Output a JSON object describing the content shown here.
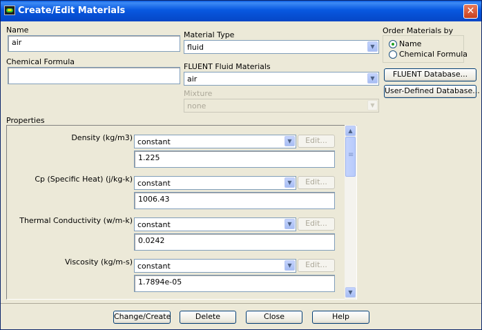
{
  "window": {
    "title": "Create/Edit Materials",
    "close_glyph": "✕"
  },
  "name": {
    "label": "Name",
    "value": "air"
  },
  "chemical_formula": {
    "label": "Chemical Formula",
    "value": ""
  },
  "material_type": {
    "label": "Material Type",
    "value": "fluid"
  },
  "fluent_materials": {
    "label": "FLUENT Fluid Materials",
    "value": "air"
  },
  "mixture": {
    "label": "Mixture",
    "value": "none"
  },
  "order_by": {
    "label": "Order Materials by",
    "options": [
      {
        "label": "Name",
        "selected": true
      },
      {
        "label": "Chemical Formula",
        "selected": false
      }
    ]
  },
  "database_buttons": {
    "fluent": "FLUENT Database...",
    "user": "User-Defined Database..."
  },
  "properties": {
    "label": "Properties",
    "items": [
      {
        "label": "Density (kg/m3)",
        "method": "constant",
        "edit": "Edit...",
        "value": "1.225"
      },
      {
        "label": "Cp (Specific Heat) (j/kg-k)",
        "method": "constant",
        "edit": "Edit...",
        "value": "1006.43"
      },
      {
        "label": "Thermal Conductivity (w/m-k)",
        "method": "constant",
        "edit": "Edit...",
        "value": "0.0242"
      },
      {
        "label": "Viscosity (kg/m-s)",
        "method": "constant",
        "edit": "Edit...",
        "value": "1.7894e-05"
      }
    ]
  },
  "buttons": {
    "change_create": "Change/Create",
    "delete": "Delete",
    "close": "Close",
    "help": "Help"
  },
  "icons": {
    "dropdown_arrow": "▼",
    "scroll_up": "▲",
    "scroll_down": "▼"
  },
  "colors": {
    "title_bar": "#0a5be0",
    "dialog_bg": "#ece9d8",
    "field_border": "#7f9db9"
  }
}
